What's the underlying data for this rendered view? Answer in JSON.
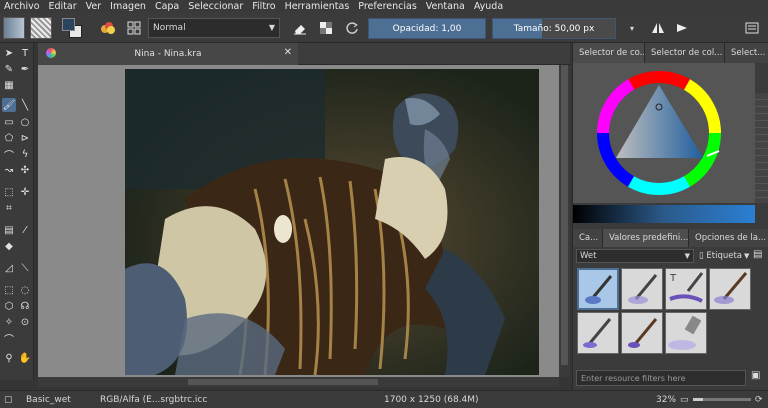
{
  "menu": [
    "Archivo",
    "Editar",
    "Ver",
    "Imagen",
    "Capa",
    "Seleccionar",
    "Filtro",
    "Herramientas",
    "Preferencias",
    "Ventana",
    "Ayuda"
  ],
  "toolbar": {
    "blend_mode": "Normal",
    "opacity_label": "Opacidad:",
    "opacity_value": "1,00",
    "size_label": "Tamaño:",
    "size_value": "50,00 px"
  },
  "document": {
    "tab_title": "Nina - Nina.kra"
  },
  "right_panel": {
    "tabs": [
      "Selector de co...",
      "Selector de col...",
      "Select..."
    ],
    "bottom_tabs": [
      "Ca...",
      "Valores predefini...",
      "Opciones de la..."
    ],
    "preset_tag": "Wet",
    "tag_label": "Etiqueta",
    "filter_placeholder": "Enter resource filters here"
  },
  "status": {
    "brush": "Basic_wet",
    "color_space": "RGB/Alfa (E...srgbtrc.icc",
    "dimensions": "1700 x 1250 (68.4M)",
    "zoom": "32%"
  },
  "colors": {
    "accent": "#4e6f94",
    "panel": "#3b3b3b",
    "menubar": "#3a3a3a"
  }
}
